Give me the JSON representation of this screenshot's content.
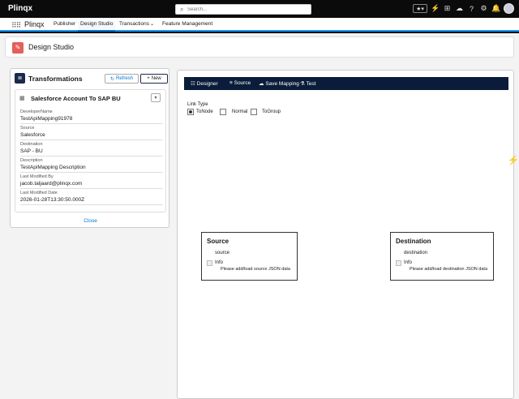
{
  "topbar": {
    "brand": "Plinqx",
    "search_placeholder": "Search..."
  },
  "nav": {
    "app_name": "Plinqx",
    "items": [
      "Publisher",
      "Design Studio",
      "Transactions",
      "Feature Management"
    ]
  },
  "page": {
    "title": "Design Studio"
  },
  "left": {
    "title": "Transformations",
    "refresh_label": "Refresh",
    "new_label": "New",
    "record_title": "Salesforce Account To SAP BU",
    "fields": [
      {
        "label": "DeveloperName",
        "value": "TestApiMapping91978"
      },
      {
        "label": "Source",
        "value": "Salesforce"
      },
      {
        "label": "Destination",
        "value": "SAP - BU"
      },
      {
        "label": "Description",
        "value": "TestApiMapping Description"
      },
      {
        "label": "Last Modified By",
        "value": "jacob.taljaard@plinqx.com"
      },
      {
        "label": "Last Modified Date",
        "value": "2026-01-28T13:30:50.000Z"
      }
    ],
    "close_label": "Close"
  },
  "designer": {
    "toolbar": [
      "Designer",
      "Source",
      "Save Mapping",
      "Test"
    ],
    "link_type_label": "Link Type",
    "link_types": [
      "ToNode",
      "Normal",
      "ToGroup"
    ],
    "selected_link_type": "ToNode",
    "source_node": {
      "title": "Source",
      "sub": "source",
      "info": "Info",
      "msg": "Please add/load source JSON data"
    },
    "dest_node": {
      "title": "Destination",
      "sub": "destination",
      "info": "Info",
      "msg": "Please add/load destination JSON data"
    }
  }
}
